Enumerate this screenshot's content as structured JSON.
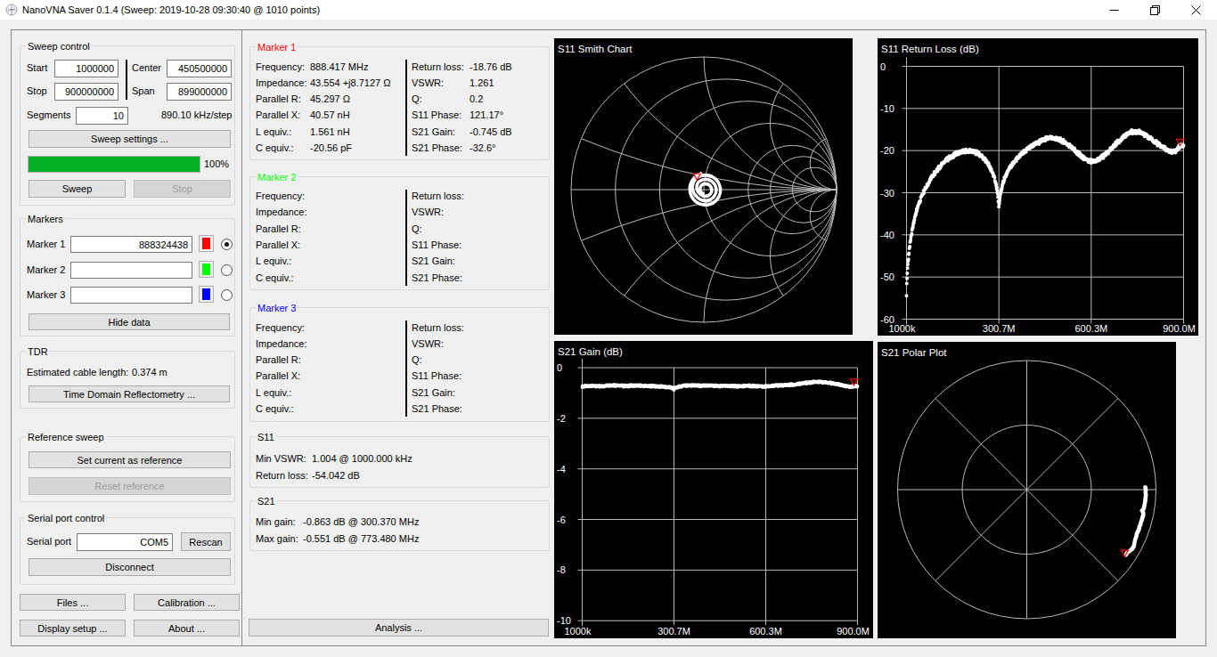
{
  "window": {
    "title": "NanoVNA Saver 0.1.4 (Sweep: 2019-10-28 09:30:40 @ 1010 points)"
  },
  "sweep_control": {
    "title": "Sweep control",
    "start_label": "Start",
    "start_value": "1000000",
    "center_label": "Center",
    "center_value": "450500000",
    "stop_label": "Stop",
    "stop_value": "900000000",
    "span_label": "Span",
    "span_value": "899000000",
    "segments_label": "Segments",
    "segments_value": "10",
    "step_text": "890.10 kHz/step",
    "sweep_settings_button": "Sweep settings ...",
    "progress_percent": "100%",
    "progress_value": 100,
    "progress_color": "#06b025",
    "sweep_button": "Sweep",
    "stop_button": "Stop"
  },
  "markers_panel": {
    "title": "Markers",
    "rows": [
      {
        "label": "Marker 1",
        "value": "888324438",
        "color": "#ff0000",
        "selected": true
      },
      {
        "label": "Marker 2",
        "value": "",
        "color": "#00ff00",
        "selected": false
      },
      {
        "label": "Marker 3",
        "value": "",
        "color": "#0000ff",
        "selected": false
      }
    ],
    "hide_data_button": "Hide data"
  },
  "tdr": {
    "title": "TDR",
    "cable_length_label": "Estimated cable length:",
    "cable_length_value": "0.374 m",
    "button": "Time Domain Reflectometry ..."
  },
  "reference": {
    "title": "Reference sweep",
    "set_button": "Set current as reference",
    "reset_button": "Reset reference"
  },
  "serial": {
    "title": "Serial port control",
    "port_label": "Serial port",
    "port_value": "COM5",
    "rescan_button": "Rescan",
    "disconnect_button": "Disconnect"
  },
  "bottom_buttons": {
    "files": "Files ...",
    "calibration": "Calibration ...",
    "display_setup": "Display setup ...",
    "about": "About ..."
  },
  "marker_info": {
    "left_labels": [
      "Frequency:",
      "Impedance:",
      "Parallel R:",
      "Parallel X:",
      "L equiv.:",
      "C equiv.:"
    ],
    "right_labels": [
      "Return loss:",
      "VSWR:",
      "Q:",
      "S11 Phase:",
      "S21 Gain:",
      "S21 Phase:"
    ],
    "markers": [
      {
        "title": "Marker 1",
        "color": "#ff0000",
        "left_values": [
          "888.417 MHz",
          "43.554 +j8.7127 Ω",
          "45.297 Ω",
          "40.57 nH",
          "1.561 nH",
          "-20.56 pF"
        ],
        "right_values": [
          "-18.76 dB",
          "1.261",
          "0.2",
          "121.17°",
          "-0.745 dB",
          "-32.6°"
        ]
      },
      {
        "title": "Marker 2",
        "color": "#00ff00",
        "left_values": [
          "",
          "",
          "",
          "",
          "",
          ""
        ],
        "right_values": [
          "",
          "",
          "",
          "",
          "",
          ""
        ]
      },
      {
        "title": "Marker 3",
        "color": "#0000ff",
        "left_values": [
          "",
          "",
          "",
          "",
          "",
          ""
        ],
        "right_values": [
          "",
          "",
          "",
          "",
          "",
          ""
        ]
      }
    ]
  },
  "s11_info": {
    "title": "S11",
    "rows": [
      {
        "label": "Min VSWR:",
        "value": "1.004 @ 1000.000 kHz"
      },
      {
        "label": "Return loss:",
        "value": "-54.042 dB"
      }
    ]
  },
  "s21_info": {
    "title": "S21",
    "rows": [
      {
        "label": "Min gain:",
        "value": "-0.863 dB @ 300.370 MHz"
      },
      {
        "label": "Max gain:",
        "value": "-0.551 dB @ 773.480 MHz"
      }
    ]
  },
  "analysis_button": "Analysis ...",
  "chart_data": [
    {
      "id": "smith",
      "type": "smith",
      "title": "S11 Smith Chart",
      "resistance_circles": [
        0.2,
        0.5,
        1,
        2,
        3,
        5
      ],
      "reactance_arcs": [
        0.2,
        0.5,
        1,
        2,
        5
      ],
      "trace": {
        "kind": "gamma-from-return-loss",
        "phase_deg_at_marker": 121.17,
        "marker_freq_mhz": 888.417,
        "total_turns": 3.37
      },
      "marker": {
        "x": 160.3,
        "y": 152
      },
      "grid_color": "#b9b9b9",
      "text_color": "#ffffff",
      "trace_color": "#ffffff",
      "marker_color": "#ff0000",
      "bg": "#000000"
    },
    {
      "id": "rl",
      "type": "line",
      "title": "S11 Return Loss (dB)",
      "x_tick_labels": [
        "1000k",
        "300.7M",
        "600.3M",
        "900.0M"
      ],
      "x_ticks_mhz": [
        1,
        300.7,
        600.3,
        900.0
      ],
      "y_ticks": [
        0,
        -10,
        -20,
        -30,
        -40,
        -50,
        -60
      ],
      "ylim": [
        0,
        -60
      ],
      "xlim_mhz": [
        1,
        900
      ],
      "marker_freq_mhz": 888.32,
      "series_mhz": [
        1,
        2,
        4,
        7,
        10,
        14,
        19,
        25,
        32,
        40,
        50,
        62,
        75,
        90,
        105,
        120,
        135,
        150,
        165,
        180,
        195,
        210,
        225,
        240,
        255,
        268,
        280,
        290,
        296,
        300.7,
        305,
        310,
        317,
        325,
        335,
        347,
        360,
        375,
        390,
        405,
        420,
        435,
        450,
        462,
        475,
        488,
        500,
        515,
        530,
        545,
        560,
        575,
        588,
        600,
        612,
        625,
        640,
        655,
        670,
        685,
        700,
        715,
        728,
        740,
        752,
        765,
        778,
        790,
        802,
        815,
        828,
        840,
        852,
        862,
        872,
        880,
        886,
        892,
        900
      ],
      "series_db": [
        -54,
        -51.5,
        -48.5,
        -45.5,
        -43.5,
        -41.3,
        -39,
        -36.8,
        -34.7,
        -32.8,
        -30.8,
        -28.9,
        -27.2,
        -25.6,
        -24.2,
        -23,
        -22,
        -21.2,
        -20.7,
        -20.3,
        -20.1,
        -20.1,
        -20.4,
        -21,
        -22,
        -23.4,
        -25.2,
        -27.6,
        -29.8,
        -33.3,
        -30.8,
        -28.8,
        -27,
        -25.6,
        -24.3,
        -23,
        -21.9,
        -20.8,
        -19.9,
        -19.1,
        -18.4,
        -17.8,
        -17.3,
        -17.1,
        -17,
        -17.2,
        -17.5,
        -18.1,
        -18.9,
        -19.8,
        -20.8,
        -21.7,
        -22.3,
        -22.6,
        -22.5,
        -22.1,
        -21.3,
        -20.3,
        -19.2,
        -18.1,
        -17,
        -16.2,
        -15.7,
        -15.5,
        -15.5,
        -15.8,
        -16.3,
        -16.9,
        -17.6,
        -18.3,
        -19,
        -19.6,
        -20,
        -20.2,
        -20.1,
        -19.6,
        -19.1,
        -18.85,
        -18.6
      ],
      "grid_color": "#b9b9b9",
      "text_color": "#ffffff",
      "trace_color": "#ffffff",
      "marker_color": "#ff0000",
      "bg": "#000000"
    },
    {
      "id": "gain",
      "type": "line",
      "title": "S21 Gain (dB)",
      "x_tick_labels": [
        "1000k",
        "300.7M",
        "600.3M",
        "900.0M"
      ],
      "x_ticks_mhz": [
        1,
        300.7,
        600.3,
        900.0
      ],
      "y_ticks": [
        0,
        -2,
        -4,
        -6,
        -8,
        -10
      ],
      "ylim": [
        0,
        -10
      ],
      "xlim_mhz": [
        1,
        900
      ],
      "marker_freq_mhz": 888.32,
      "series_mhz": [
        1,
        30,
        60,
        100,
        140,
        180,
        220,
        260,
        295,
        300.4,
        306,
        330,
        360,
        390,
        420,
        450,
        480,
        510,
        540,
        570,
        600,
        620,
        650,
        680,
        710,
        740,
        760,
        773.5,
        790,
        810,
        830,
        850,
        865,
        880,
        890,
        900
      ],
      "series_db": [
        -0.74,
        -0.72,
        -0.73,
        -0.7,
        -0.72,
        -0.71,
        -0.73,
        -0.74,
        -0.8,
        -0.863,
        -0.79,
        -0.72,
        -0.7,
        -0.72,
        -0.71,
        -0.73,
        -0.72,
        -0.74,
        -0.72,
        -0.73,
        -0.75,
        -0.72,
        -0.7,
        -0.68,
        -0.64,
        -0.59,
        -0.56,
        -0.551,
        -0.57,
        -0.6,
        -0.65,
        -0.69,
        -0.73,
        -0.75,
        -0.73,
        -0.72
      ],
      "grid_color": "#b9b9b9",
      "text_color": "#ffffff",
      "trace_color": "#ffffff",
      "marker_color": "#ff0000",
      "bg": "#000000"
    },
    {
      "id": "polar",
      "type": "polar",
      "title": "S21 Polar Plot",
      "trace": {
        "start_deg": 1.2,
        "end_deg": -33.4,
        "radius_frac_db_series": true
      },
      "marker": {
        "angle_deg": -32.9,
        "radius_frac": 0.903
      },
      "grid_color": "#b9b9b9",
      "text_color": "#ffffff",
      "trace_color": "#ffffff",
      "marker_color": "#ff0000",
      "bg": "#000000"
    }
  ]
}
